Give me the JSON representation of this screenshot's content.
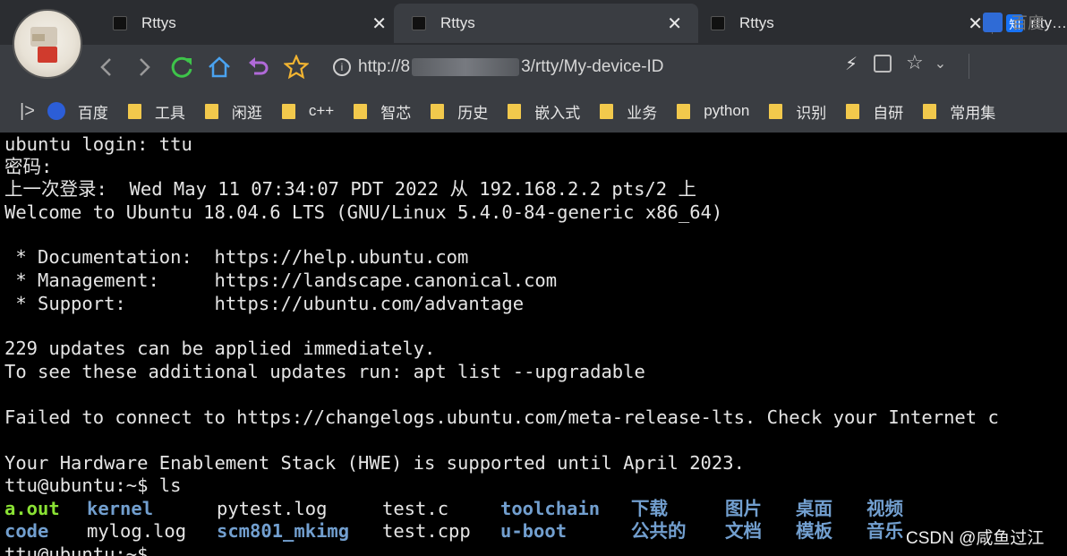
{
  "tabs": [
    {
      "title": "Rttys",
      "close": "✕"
    },
    {
      "title": "Rttys",
      "close": "✕"
    },
    {
      "title": "Rttys",
      "close": "✕"
    },
    {
      "title": "rtty…",
      "icon_text": "知"
    }
  ],
  "toolbar": {
    "url_prefix": "http://8",
    "url_suffix": "3/rtty/My-device-ID",
    "search_engine": "百度"
  },
  "bookmarks": {
    "toggle": "|>",
    "items": [
      {
        "label": "百度",
        "icon": "baidu-paw-icon"
      },
      {
        "label": "工具",
        "icon": "folder-icon"
      },
      {
        "label": "闲逛",
        "icon": "folder-icon"
      },
      {
        "label": "c++",
        "icon": "folder-icon"
      },
      {
        "label": "智芯",
        "icon": "folder-icon"
      },
      {
        "label": "历史",
        "icon": "folder-icon"
      },
      {
        "label": "嵌入式",
        "icon": "folder-icon"
      },
      {
        "label": "业务",
        "icon": "folder-icon"
      },
      {
        "label": "python",
        "icon": "folder-icon"
      },
      {
        "label": "识别",
        "icon": "folder-icon"
      },
      {
        "label": "自研",
        "icon": "folder-icon"
      },
      {
        "label": "常用集",
        "icon": "folder-icon"
      }
    ]
  },
  "terminal": {
    "lines": [
      "ubuntu login: ttu",
      "密码:",
      "上一次登录:  Wed May 11 07:34:07 PDT 2022 从 192.168.2.2 pts/2 上",
      "Welcome to Ubuntu 18.04.6 LTS (GNU/Linux 5.4.0-84-generic x86_64)",
      "",
      " * Documentation:  https://help.ubuntu.com",
      " * Management:     https://landscape.canonical.com",
      " * Support:        https://ubuntu.com/advantage",
      "",
      "229 updates can be applied immediately.",
      "To see these additional updates run: apt list --upgradable",
      "",
      "Failed to connect to https://changelogs.ubuntu.com/meta-release-lts. Check your Internet c",
      "",
      "Your Hardware Enablement Stack (HWE) is supported until April 2023.",
      "ttu@ubuntu:~$ ls"
    ],
    "ls_row1": [
      "a.out",
      "kernel",
      "pytest.log",
      "test.c",
      "toolchain",
      "下载",
      "图片",
      "桌面",
      "视频"
    ],
    "ls_row2": [
      "code",
      "mylog.log",
      "scm801_mkimg",
      "test.cpp",
      "u-boot",
      "公共的",
      "文档",
      "模板",
      "音乐"
    ],
    "prompt_last": "ttu@ubuntu:~$",
    "colors": {
      "exec": "#8ae234",
      "dir": "#729fcf",
      "text": "#e5e5e5"
    }
  },
  "watermark": "CSDN @咸鱼过江"
}
